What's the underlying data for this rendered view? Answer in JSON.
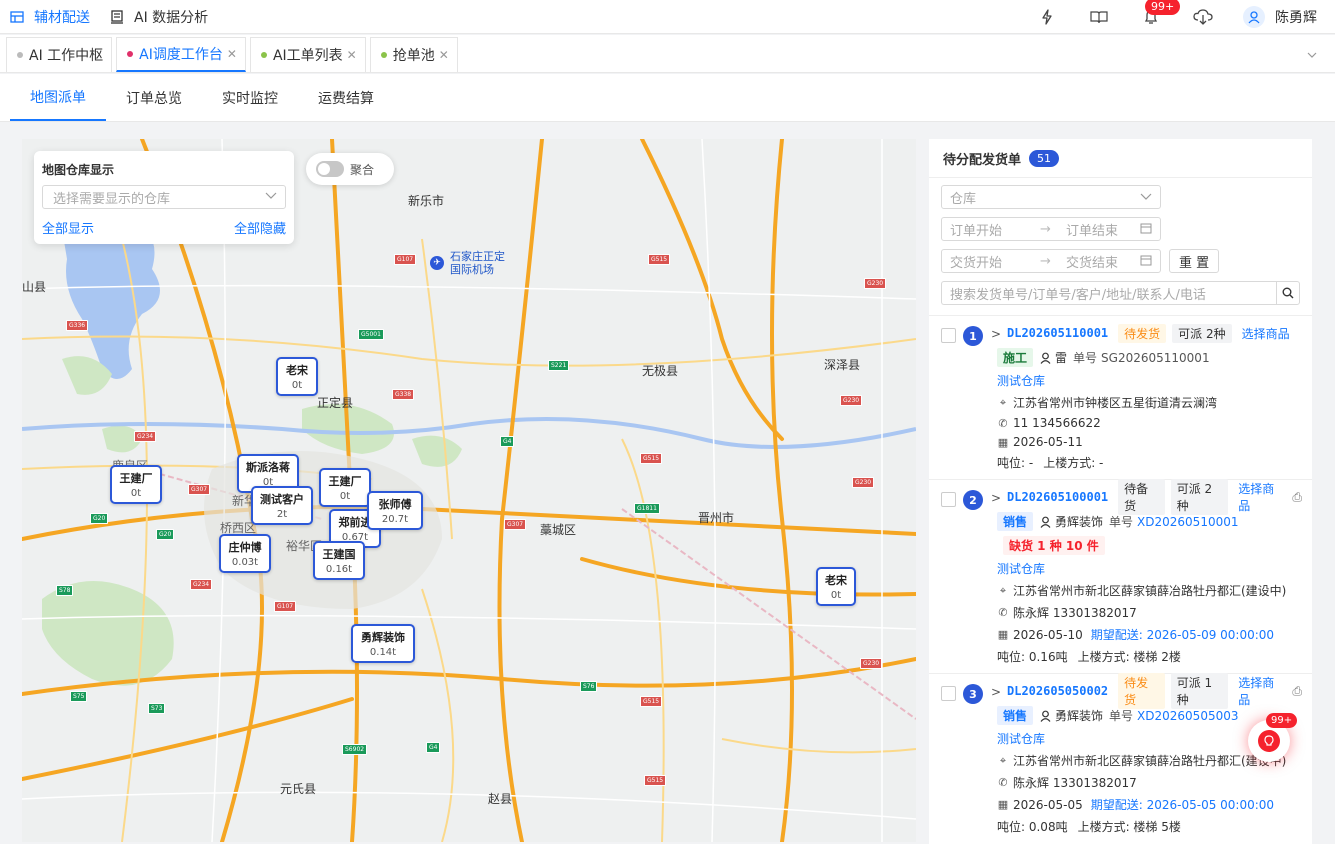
{
  "top_nav": {
    "items": [
      {
        "label": "辅材配送",
        "active": true
      },
      {
        "label": "AI 数据分析",
        "active": false
      }
    ],
    "notification_badge": "99+",
    "user_name": "陈勇辉"
  },
  "tabs": [
    {
      "label": "AI 工作中枢",
      "dot_color": "#bbbbbb",
      "closable": false,
      "active": false
    },
    {
      "label": "AI调度工作台",
      "dot_color": "#e0306a",
      "closable": true,
      "active": true
    },
    {
      "label": "AI工单列表",
      "dot_color": "#8bc34a",
      "closable": true,
      "active": false
    },
    {
      "label": "抢单池",
      "dot_color": "#8bc34a",
      "closable": true,
      "active": false
    }
  ],
  "subtabs": [
    "地图派单",
    "订单总览",
    "实时监控",
    "运费结算"
  ],
  "map": {
    "warehouse_panel": {
      "title": "地图仓库显示",
      "placeholder": "选择需要显示的仓库",
      "show_all": "全部显示",
      "hide_all": "全部隐藏"
    },
    "aggregate_label": "聚合",
    "place_labels": [
      "新乐市",
      "石家庄正定国际机场",
      "山县",
      "无极县",
      "深泽县",
      "正定县",
      "藁城区",
      "晋州市",
      "元氏县",
      "赵县",
      "桥西区",
      "裕华区",
      "新华区",
      "鹿泉区"
    ],
    "road_badges": [
      "G107",
      "G515",
      "G336",
      "G5001",
      "S221",
      "G338",
      "G230",
      "G234",
      "G4",
      "G1811",
      "G307",
      "G20",
      "G307",
      "G234",
      "G107",
      "S78",
      "G20",
      "S75",
      "S73",
      "S76",
      "G515",
      "S6902",
      "G4",
      "G515",
      "G515",
      "G230",
      "G230",
      "G230"
    ],
    "markers": [
      {
        "name": "老宋",
        "value": "0t"
      },
      {
        "name": "斯派洛蒋",
        "value": "0t"
      },
      {
        "name": "王建厂",
        "value": "0t"
      },
      {
        "name": "王建厂",
        "value": "0t"
      },
      {
        "name": "测试客户",
        "value": "2t"
      },
      {
        "name": "张师傅",
        "value": "20.7t"
      },
      {
        "name": "郑前进",
        "value": "0.67t"
      },
      {
        "name": "王建国",
        "value": "0.16t"
      },
      {
        "name": "庄仲博",
        "value": "0.03t"
      },
      {
        "name": "勇辉装饰",
        "value": "0.14t"
      },
      {
        "name": "老宋",
        "value": "0t"
      }
    ]
  },
  "right_panel": {
    "title": "待分配发货单",
    "count": "51",
    "filters": {
      "warehouse_placeholder": "仓库",
      "order_start": "订单开始",
      "order_end": "订单结束",
      "delivery_start": "交货开始",
      "delivery_end": "交货结束",
      "reset": "重 置",
      "search_placeholder": "搜索发货单号/订单号/客户/地址/联系人/电话"
    },
    "orders": [
      {
        "index": "1",
        "no": "DL202605110001",
        "status": "待发货",
        "dispatch": "可派 2种",
        "choose": "选择商品",
        "type": "施工",
        "person": "雷",
        "ref_label": "单号",
        "ref": "SG202605110001",
        "shortage": "",
        "warehouse": "测试仓库",
        "address": "江苏省常州市钟楼区五星街道清云澜湾",
        "phone": "11 134566622",
        "date": "2026-05-11",
        "expected": "",
        "tonnage": "吨位: -",
        "floor": "上楼方式: -"
      },
      {
        "index": "2",
        "no": "DL202605100001",
        "status": "待备货",
        "dispatch": "可派 2种",
        "choose": "选择商品",
        "type": "销售",
        "person": "勇辉装饰",
        "ref_label": "单号",
        "ref": "XD20260510001",
        "shortage": "缺货 1 种 10 件",
        "warehouse": "测试仓库",
        "address": "江苏省常州市新北区薛家镇薛冶路牡丹都汇(建设中)",
        "phone": "陈永辉 13301382017",
        "date": "2026-05-10",
        "expected": "期望配送: 2026-05-09 00:00:00",
        "tonnage": "吨位: 0.16吨",
        "floor": "上楼方式: 楼梯 2楼"
      },
      {
        "index": "3",
        "no": "DL202605050002",
        "status": "待发货",
        "dispatch": "可派 1种",
        "choose": "选择商品",
        "type": "销售",
        "person": "勇辉装饰",
        "ref_label": "单号",
        "ref": "XD20260505003",
        "shortage": "",
        "warehouse": "测试仓库",
        "address": "江苏省常州市新北区薛家镇薛冶路牡丹都汇(建设中)",
        "phone": "陈永辉 13301382017",
        "date": "2026-05-05",
        "expected": "期望配送: 2026-05-05 00:00:00",
        "tonnage": "吨位: 0.08吨",
        "floor": "上楼方式: 楼梯 5楼"
      }
    ]
  },
  "float_badge": "99+"
}
